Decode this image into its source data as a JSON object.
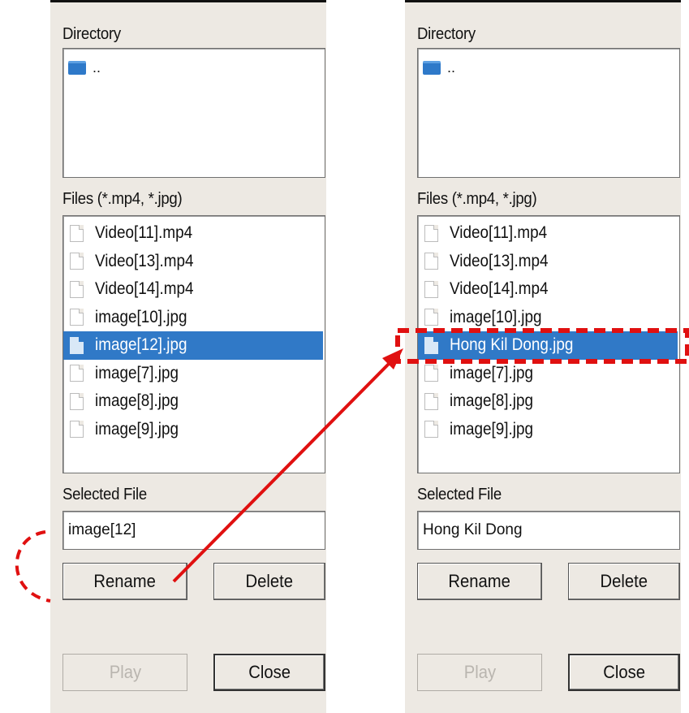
{
  "panels": [
    {
      "directory_label": "Directory",
      "directory_item": "..",
      "files_label": "Files (*.mp4, *.jpg)",
      "files": [
        "Video[11].mp4",
        "Video[13].mp4",
        "Video[14].mp4",
        "image[10].jpg",
        "image[12].jpg",
        "image[7].jpg",
        "image[8].jpg",
        "image[9].jpg"
      ],
      "selected_index": 4,
      "selected_file_label": "Selected File",
      "selected_file_value": "image[12]",
      "rename_label": "Rename",
      "delete_label": "Delete",
      "play_label": "Play",
      "close_label": "Close"
    },
    {
      "directory_label": "Directory",
      "directory_item": "..",
      "files_label": "Files (*.mp4, *.jpg)",
      "files": [
        "Video[11].mp4",
        "Video[13].mp4",
        "Video[14].mp4",
        "image[10].jpg",
        "Hong Kil Dong.jpg",
        "image[7].jpg",
        "image[8].jpg",
        "image[9].jpg"
      ],
      "selected_index": 4,
      "selected_file_label": "Selected File",
      "selected_file_value": "Hong Kil Dong",
      "rename_label": "Rename",
      "delete_label": "Delete",
      "play_label": "Play",
      "close_label": "Close"
    }
  ],
  "icons": {
    "folder": "folder-icon",
    "file": "file-icon"
  },
  "colors": {
    "selection": "#3079c7",
    "annotation": "#e01010",
    "panel_bg": "#ede9e3"
  }
}
